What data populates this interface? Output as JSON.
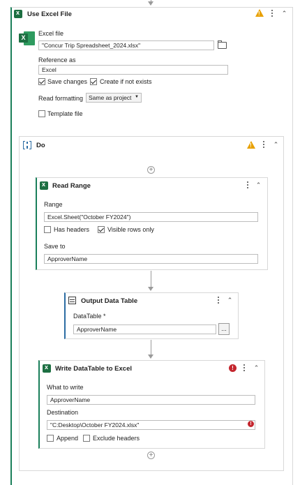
{
  "use_excel": {
    "title": "Use Excel File",
    "excel_file_label": "Excel file",
    "excel_file_value": "\"Concur Trip Spreadsheet_2024.xlsx\"",
    "reference_label": "Reference as",
    "reference_value": "Excel",
    "save_changes_label": "Save changes",
    "create_if_not_exists_label": "Create if not exists",
    "read_formatting_label": "Read formatting",
    "read_formatting_value": "Same as project",
    "template_file_label": "Template file",
    "save_changes_checked": true,
    "create_if_not_exists_checked": true,
    "template_file_checked": false
  },
  "do_block": {
    "title": "Do"
  },
  "read_range": {
    "title": "Read Range",
    "range_label": "Range",
    "range_value": "Excel.Sheet(\"October FY2024\")",
    "has_headers_label": "Has headers",
    "visible_rows_label": "Visible rows only",
    "save_to_label": "Save to",
    "save_to_value": "ApproverName",
    "has_headers_checked": false,
    "visible_rows_checked": true
  },
  "output_dt": {
    "title": "Output Data Table",
    "datatable_label": "DataTable *",
    "datatable_value": "ApproverName",
    "browse_label": "..."
  },
  "write_dt": {
    "title": "Write DataTable to Excel",
    "what_to_write_label": "What to write",
    "what_to_write_value": "ApproverName",
    "destination_label": "Destination",
    "destination_value": "\"C:Desktop\\October FY2024.xlsx\"",
    "append_label": "Append",
    "exclude_headers_label": "Exclude headers",
    "append_checked": false,
    "exclude_headers_checked": false
  },
  "colors": {
    "accent": "#1a7f5a",
    "warning": "#e8a000",
    "error": "#c4262e",
    "excel": "#1d6f42"
  }
}
